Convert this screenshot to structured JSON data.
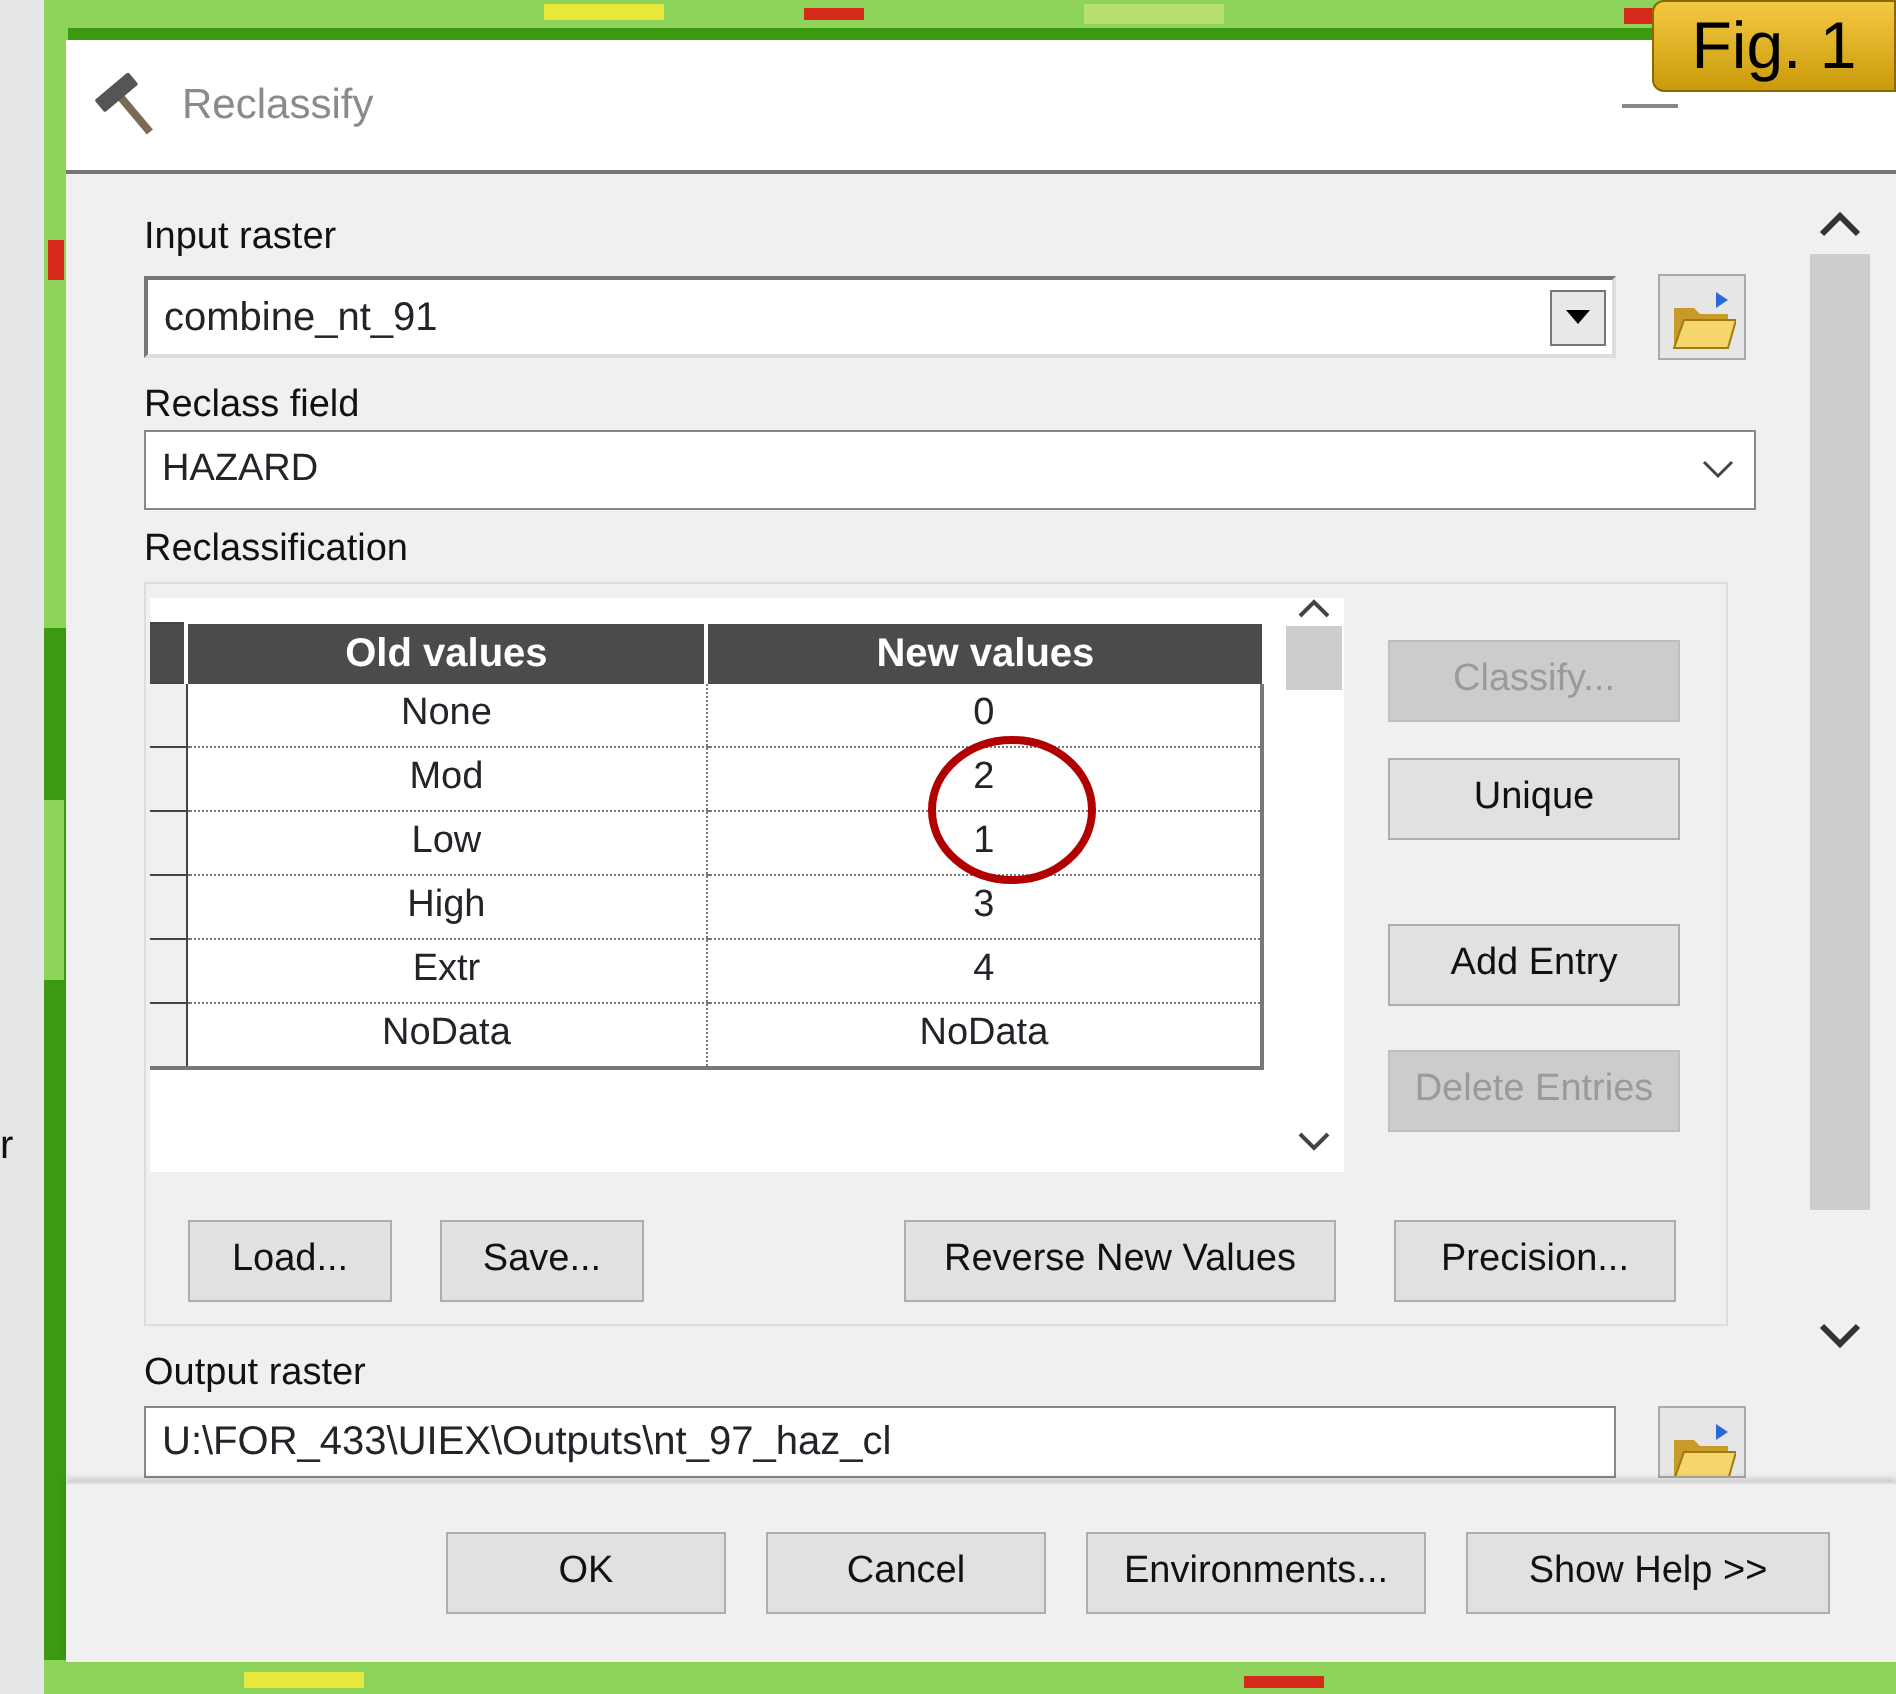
{
  "window": {
    "title": "Reclassify",
    "badge": "Fig. 1"
  },
  "background_text": "r",
  "input_raster": {
    "label": "Input raster",
    "value": "combine_nt_91"
  },
  "reclass_field": {
    "label": "Reclass field",
    "value": "HAZARD"
  },
  "reclassification": {
    "label": "Reclassification",
    "columns": [
      "Old values",
      "New values"
    ],
    "rows": [
      {
        "old": "None",
        "new": "0"
      },
      {
        "old": "Mod",
        "new": "2"
      },
      {
        "old": "Low",
        "new": "1"
      },
      {
        "old": "High",
        "new": "3"
      },
      {
        "old": "Extr",
        "new": "4"
      },
      {
        "old": "NoData",
        "new": "NoData"
      }
    ],
    "side_buttons": [
      {
        "label": "Classify...",
        "disabled": true
      },
      {
        "label": "Unique",
        "disabled": false
      },
      {
        "label": "Add Entry",
        "disabled": false
      },
      {
        "label": "Delete Entries",
        "disabled": true
      }
    ],
    "bottom_buttons": [
      "Load...",
      "Save...",
      "Reverse New Values",
      "Precision..."
    ]
  },
  "output_raster": {
    "label": "Output raster",
    "value": "U:\\FOR_433\\UIEX\\Outputs\\nt_97_haz_cl"
  },
  "buttons": [
    "OK",
    "Cancel",
    "Environments...",
    "Show Help >>"
  ]
}
